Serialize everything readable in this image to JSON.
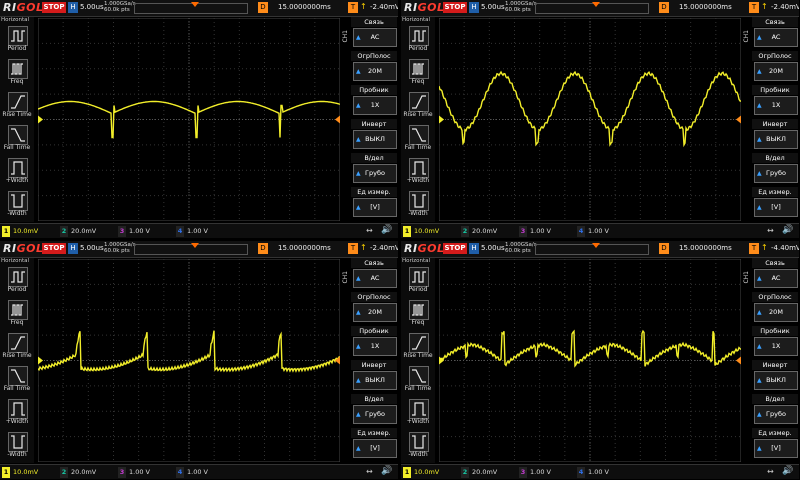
{
  "app": {
    "brand_left": "RI",
    "brand_right": "GOL"
  },
  "colors": {
    "ch1": "#f2ee2a",
    "ch2": "#17c6a3",
    "ch3": "#c23bd0",
    "ch4": "#2f6fe8",
    "stop": "#d41b1b",
    "trigger": "#ff8c1a"
  },
  "panels": [
    {
      "status": "STOP",
      "h_label": "H",
      "timebase": "5.00us",
      "sample_rate": "1.000GSa/s",
      "points": "60.0k pts",
      "d_label": "D",
      "delay": "15.0000000ms",
      "t_label": "T",
      "trigger_level": "-2.40mV",
      "left_menu": {
        "header": "Horizontal",
        "items": [
          "Period",
          "Freq",
          "Rise Time",
          "Fall Time",
          "+Width",
          "-Width"
        ]
      },
      "channel_label": "CH1",
      "right_menu": [
        {
          "title": "Связь",
          "value": "AC"
        },
        {
          "title": "ОгрПолос",
          "value": "20M"
        },
        {
          "title": "Пробник",
          "value": "1X"
        },
        {
          "title": "Инверт",
          "value": "ВЫКЛ"
        },
        {
          "title": "В/дел",
          "value": "Грубо"
        },
        {
          "title": "Ед измер.",
          "value": "[V]"
        }
      ],
      "channels": [
        {
          "num": "1",
          "value": "10.0mV"
        },
        {
          "num": "2",
          "value": "20.0mV"
        },
        {
          "num": "3",
          "value": "1.00 V"
        },
        {
          "num": "4",
          "value": "1.00 V"
        }
      ]
    },
    {
      "status": "STOP",
      "h_label": "H",
      "timebase": "5.00us",
      "sample_rate": "1.000GSa/s",
      "points": "60.0k pts",
      "d_label": "D",
      "delay": "15.0000000ms",
      "t_label": "T",
      "trigger_level": "-2.40mV",
      "left_menu": {
        "header": "Horizontal",
        "items": [
          "Period",
          "Freq",
          "Rise Time",
          "Fall Time",
          "+Width",
          "-Width"
        ]
      },
      "channel_label": "CH1",
      "right_menu": [
        {
          "title": "Связь",
          "value": "AC"
        },
        {
          "title": "ОгрПолос",
          "value": "20M"
        },
        {
          "title": "Пробник",
          "value": "1X"
        },
        {
          "title": "Инверт",
          "value": "ВЫКЛ"
        },
        {
          "title": "В/дел",
          "value": "Грубо"
        },
        {
          "title": "Ед измер.",
          "value": "[V]"
        }
      ],
      "channels": [
        {
          "num": "1",
          "value": "10.0mV"
        },
        {
          "num": "2",
          "value": "20.0mV"
        },
        {
          "num": "3",
          "value": "1.00 V"
        },
        {
          "num": "4",
          "value": "1.00 V"
        }
      ]
    },
    {
      "status": "STOP",
      "h_label": "H",
      "timebase": "5.00us",
      "sample_rate": "1.000GSa/s",
      "points": "60.0k pts",
      "d_label": "D",
      "delay": "15.0000000ms",
      "t_label": "T",
      "trigger_level": "-2.40mV",
      "left_menu": {
        "header": "Horizontal",
        "items": [
          "Period",
          "Freq",
          "Rise Time",
          "Fall Time",
          "+Width",
          "-Width"
        ]
      },
      "channel_label": "CH1",
      "right_menu": [
        {
          "title": "Связь",
          "value": "AC"
        },
        {
          "title": "ОгрПолос",
          "value": "20M"
        },
        {
          "title": "Пробник",
          "value": "1X"
        },
        {
          "title": "Инверт",
          "value": "ВЫКЛ"
        },
        {
          "title": "В/дел",
          "value": "Грубо"
        },
        {
          "title": "Ед измер.",
          "value": "[V]"
        }
      ],
      "channels": [
        {
          "num": "1",
          "value": "10.0mV"
        },
        {
          "num": "2",
          "value": "20.0mV"
        },
        {
          "num": "3",
          "value": "1.00 V"
        },
        {
          "num": "4",
          "value": "1.00 V"
        }
      ]
    },
    {
      "status": "STOP",
      "h_label": "H",
      "timebase": "5.00us",
      "sample_rate": "1.000GSa/s",
      "points": "60.0k pts",
      "d_label": "D",
      "delay": "15.0000000ms",
      "t_label": "T",
      "trigger_level": "-4.40mV",
      "left_menu": {
        "header": "Horizontal",
        "items": [
          "Period",
          "Freq",
          "Rise Time",
          "Fall Time",
          "+Width",
          "-Width"
        ]
      },
      "channel_label": "CH1",
      "right_menu": [
        {
          "title": "Связь",
          "value": "AC"
        },
        {
          "title": "ОгрПолос",
          "value": "20M"
        },
        {
          "title": "Пробник",
          "value": "1X"
        },
        {
          "title": "Инверт",
          "value": "ВЫКЛ"
        },
        {
          "title": "В/дел",
          "value": "Грубо"
        },
        {
          "title": "Ед измер.",
          "value": "[V]"
        }
      ],
      "channels": [
        {
          "num": "1",
          "value": "10.0mV"
        },
        {
          "num": "2",
          "value": "20.0mV"
        },
        {
          "num": "3",
          "value": "1.00 V"
        },
        {
          "num": "4",
          "value": "1.00 V"
        }
      ]
    }
  ]
}
